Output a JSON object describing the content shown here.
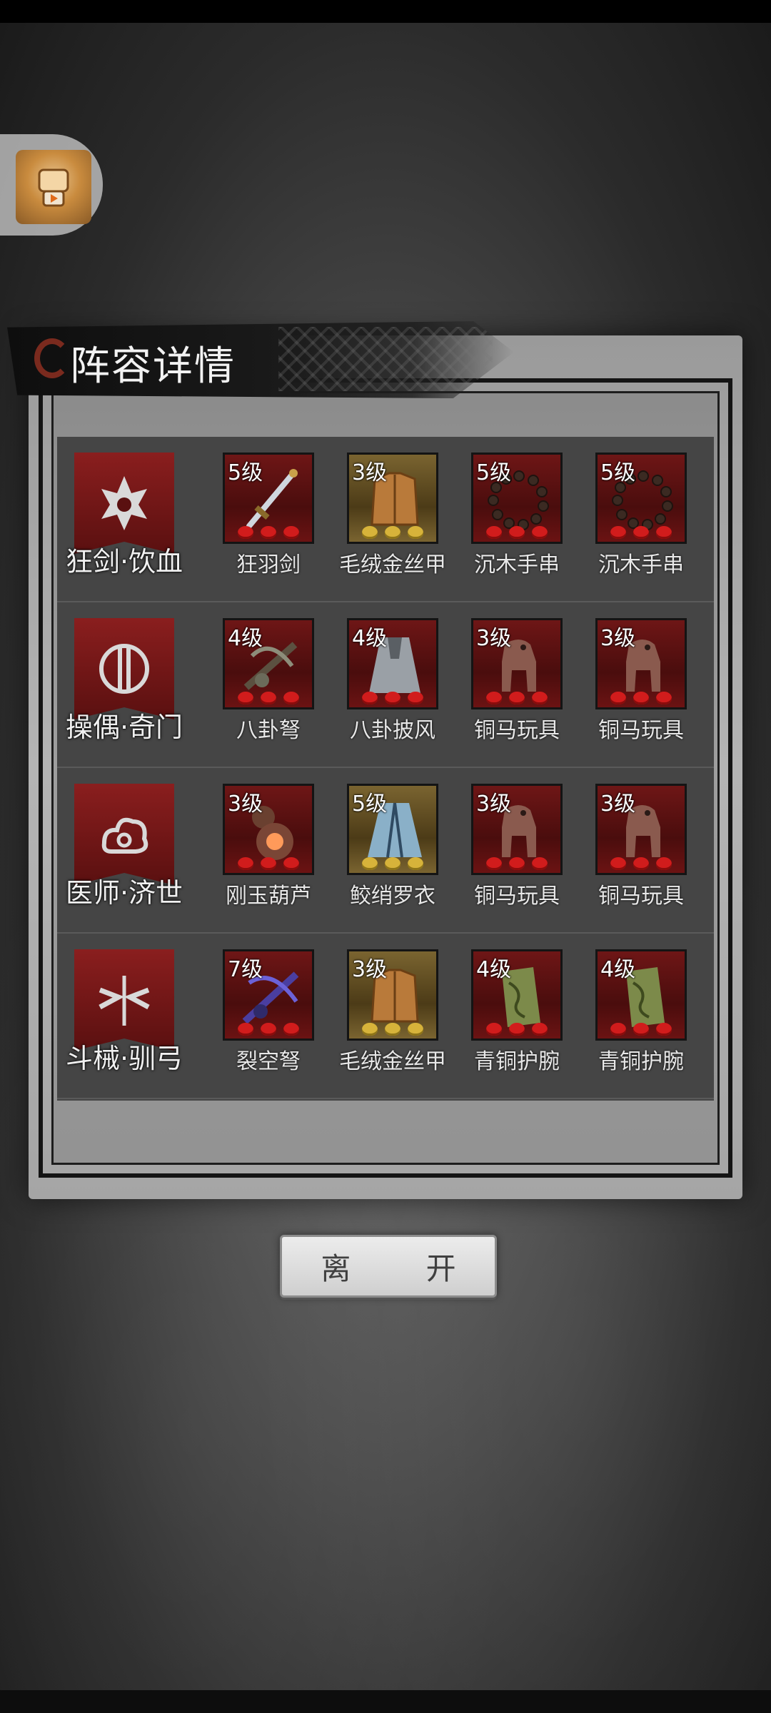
{
  "panel": {
    "title": "阵容详情"
  },
  "leave_button": {
    "label": "离  开"
  },
  "rows": [
    {
      "hero": "狂剑·饮血",
      "items": [
        {
          "level": "5级",
          "name": "狂羽剑",
          "frame": "red",
          "gems": [
            "red",
            "red",
            "red"
          ],
          "icon": "sword-icon"
        },
        {
          "level": "3级",
          "name": "毛绒金丝甲",
          "frame": "gold",
          "gems": [
            "yellow",
            "yellow",
            "yellow"
          ],
          "icon": "armor-icon"
        },
        {
          "level": "5级",
          "name": "沉木手串",
          "frame": "red",
          "gems": [
            "red",
            "red",
            "red"
          ],
          "icon": "beads-icon"
        },
        {
          "level": "5级",
          "name": "沉木手串",
          "frame": "red",
          "gems": [
            "red",
            "red",
            "red"
          ],
          "icon": "beads-icon"
        }
      ]
    },
    {
      "hero": "操偶·奇门",
      "items": [
        {
          "level": "4级",
          "name": "八卦弩",
          "frame": "red",
          "gems": [
            "red",
            "red",
            "red"
          ],
          "icon": "crossbow-icon"
        },
        {
          "level": "4级",
          "name": "八卦披风",
          "frame": "red",
          "gems": [
            "red",
            "red",
            "red"
          ],
          "icon": "cloak-icon"
        },
        {
          "level": "3级",
          "name": "铜马玩具",
          "frame": "red",
          "gems": [
            "red",
            "red",
            "red"
          ],
          "icon": "bronze-horse-icon"
        },
        {
          "level": "3级",
          "name": "铜马玩具",
          "frame": "red",
          "gems": [
            "red",
            "red",
            "red"
          ],
          "icon": "bronze-horse-icon"
        }
      ]
    },
    {
      "hero": "医师·济世",
      "items": [
        {
          "level": "3级",
          "name": "刚玉葫芦",
          "frame": "red",
          "gems": [
            "red",
            "red",
            "red"
          ],
          "icon": "gourd-icon"
        },
        {
          "level": "5级",
          "name": "鲛绡罗衣",
          "frame": "gold",
          "gems": [
            "yellow",
            "yellow",
            "yellow"
          ],
          "icon": "robe-icon"
        },
        {
          "level": "3级",
          "name": "铜马玩具",
          "frame": "red",
          "gems": [
            "red",
            "red",
            "red"
          ],
          "icon": "bronze-horse-icon"
        },
        {
          "level": "3级",
          "name": "铜马玩具",
          "frame": "red",
          "gems": [
            "red",
            "red",
            "red"
          ],
          "icon": "bronze-horse-icon"
        }
      ]
    },
    {
      "hero": "斗械·驯弓",
      "items": [
        {
          "level": "7级",
          "name": "裂空弩",
          "frame": "red",
          "gems": [
            "red",
            "red",
            "red"
          ],
          "icon": "crossbow-icon"
        },
        {
          "level": "3级",
          "name": "毛绒金丝甲",
          "frame": "gold",
          "gems": [
            "yellow",
            "yellow",
            "yellow"
          ],
          "icon": "armor-icon"
        },
        {
          "level": "4级",
          "name": "青铜护腕",
          "frame": "red",
          "gems": [
            "red",
            "red",
            "red"
          ],
          "icon": "bracer-icon"
        },
        {
          "level": "4级",
          "name": "青铜护腕",
          "frame": "red",
          "gems": [
            "red",
            "red",
            "red"
          ],
          "icon": "bracer-icon"
        }
      ]
    }
  ]
}
